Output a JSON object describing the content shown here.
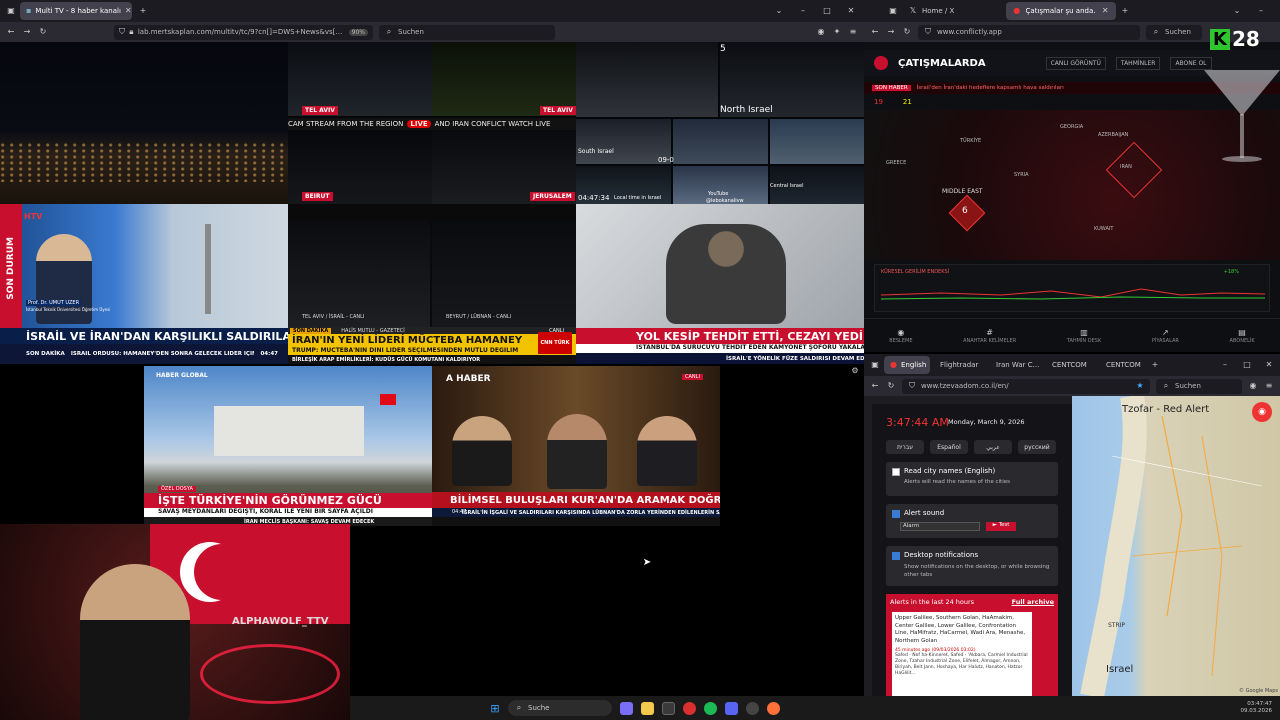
{
  "left_browser": {
    "tab_title": "Multi TV - 8 haber kanalı",
    "url": "lab.mertskaplan.com/multitv/tc/9?cn[]=DWS+News&vs[]=3h-gYIFp6Cg&cn[]=&vs[]=&cn[]=Sokak+Kedisi&vs[]=&cn[]=...",
    "zoom": "90%",
    "search_placeholder": "Suchen"
  },
  "videos": {
    "cam2_tel_aviv_1": "TEL AVIV",
    "cam2_tel_aviv_2": "TEL AVIV",
    "cam2_beirut": "BEIRUT",
    "cam2_jerusalem": "JERUSALEM",
    "cam2_ticker": "CAM STREAM FROM THE REGION",
    "cam2_live": "LIVE",
    "cam2_ticker2": "AND IRAN CONFLICT WATCH LIVE",
    "cam3_number": "5",
    "cam3_north_israel": "North Israel",
    "cam3_time": "09-0",
    "cam3_clock": "04:47:34",
    "cam3_local": "Local time in Israel",
    "cam3_south_israel": "South Israel",
    "cam3_central_israel": "Central Israel",
    "cam3_youtube": "YouTube",
    "cam3_handle": "@lebokanalivw",
    "ch4_side": "SON DURUM",
    "ch4_logo": "HTV",
    "ch4_guest": "Prof. Dr. UMUT UZER",
    "ch4_guest_sub": "İstanbul Teknik Üniversitesi Öğretim Üyesi",
    "ch4_headline": "İSRAİL VE İRAN'DAN KARŞILIKLI SALDIRILAR",
    "ch4_ticker_label": "SON DAKİKA",
    "ch4_ticker": "İSRAİL ORDUSU: HAMANEY'DEN SONRA GELECEK LİDER İÇİN LİDERİ HEDEF ALMAYA DEVAM EDECEĞİZ",
    "ch4_time": "04:47",
    "ch5_cap1": "TEL AVIV / İSRAİL - CANLI",
    "ch5_cap2": "BEYRUT / LÜBNAN - CANLI",
    "ch5_label": "SON DAKİKA",
    "ch5_guest": "HALİS MUTLU - GAZETECİ",
    "ch5_headline": "İRAN'IN YENİ LİDERİ MÜCTEBA HAMANEY",
    "ch5_sub": "TRUMP: MÜCTEBA'NIN DİNİ LİDER SEÇİLMESİNDEN MUTLU DEĞİLİM",
    "ch5_brand": "CNN TÜRK",
    "ch5_canli": "CANLI",
    "ch5_ticker": "BİRLEŞİK ARAP EMİRLİKLERİ: KUDÜS GÜCÜ KOMUTANI KALDIRIYOR",
    "ch6_headline": "YOL KESİP TEHDİT ETTİ, CEZAYI YEDİ",
    "ch6_sub": "İSTANBUL'DA SÜRÜCÜYÜ TEHDİT EDEN KAMYONET ŞOFÖRÜ YAKALANDI",
    "ch6_ticker": "İSRAİL'E YÖNELİK FÜZE SALDIRISI DEVAM EDİYOR",
    "ch7_logo": "HABER GLOBAL",
    "ch7_tag": "ÖZEL DOSYA",
    "ch7_headline": "İŞTE TÜRKİYE'NİN GÖRÜNMEZ GÜCÜ",
    "ch7_sub": "SAVAŞ MEYDANLARI DEĞİŞTİ, KORAL İLE YENİ BİR SAYFA AÇILDI",
    "ch7_ticker": "İRAN MECLİS BAŞKANI: SAVAŞ DEVAM EDECEK",
    "ch8_brand": "A HABER",
    "ch8_canli": "CANLI",
    "ch8_headline": "BİLİMSEL BULUŞLARI KUR'AN'DA ARAMAK DOĞRU MU?",
    "ch8_ticker": "İSRAİL'İN İŞGALİ VE SALDIRILARI KARŞISINDA LÜBNAN'DA ZORLA YERİNDEN EDİLENLERİN SAYISI",
    "ch8_time": "04:47",
    "webcam_text": "ALPHAWOLF_TTV"
  },
  "right_top_browser": {
    "tab1": "Home / X",
    "tab2": "Çatışmalar şu anda...",
    "url": "www.conflictly.app",
    "search_placeholder": "Suchen",
    "app_title": "ÇATIŞMALARDA",
    "nav_live": "CANLI GÖRÜNTÜ",
    "nav_forecast": "TAHMİNLER",
    "nav_subscribe": "ABONE OL",
    "alert_label": "SON HABER",
    "alert_text": "İsrail'den İran'daki hedeflere kapsamlı hava saldırıları",
    "count_stats": "19",
    "count_alerts": "21",
    "map_labels": [
      "TÜRKİYE",
      "GEORGIA",
      "AZERBAIJAN",
      "MIDDLE EAST",
      "IRAN",
      "KUWAIT",
      "GREECE",
      "SYRIA"
    ],
    "region_count": "6",
    "tension_label": "KÜRESEL GERİLİM ENDEKSİ",
    "tension_value": "+18%",
    "bottom_nav": [
      "BESLEME",
      "ANAHTAR KELİMELER",
      "TAHMİN DESK",
      "PİYASALAR",
      "ABONELİK"
    ],
    "kanal": "28"
  },
  "right_bottom_browser": {
    "tab1": "English",
    "tab2": "Flightradar",
    "tab3": "Iran War C...",
    "tab4": "CENTCOM",
    "tab5": "CENTCOM",
    "url": "www.tzevaadom.co.il/en/",
    "search_placeholder": "Suchen",
    "time": "3:47:44 AM",
    "date": "Monday, March 9, 2026",
    "lang1": "עברית",
    "lang2": "Español",
    "lang3": "عربي",
    "lang4": "русский",
    "opt1_title": "Read city names (English)",
    "opt1_desc": "Alerts will read the names of the cities",
    "opt2_title": "Alert sound",
    "opt2_select": "Alarm",
    "opt2_test": "► Test",
    "opt3_title": "Desktop notifications",
    "opt3_desc": "Show notifications on the desktop, or while browsing other tabs",
    "alerts_header": "Alerts in the last 24 hours",
    "full_archive": "Full archive",
    "alert_regions": "Upper Galilee, Southern Golan, HaAmakim, Center Galilee, Lower Galilee, Confrontation Line, HaMifratz, HaCarmel, Wadi Ara, Menashe, Northern Golan",
    "alert_time": "45 minutes ago (09/03/2026 03:02)",
    "alert_more": "Safed - Nof ha-Kinneret, Safed - 'Akbara, Carmiel Industrial Zone, Tzahar Industrial Zone, Elifelet, Almagor, Amnon, Biriyah, Beit Jann, Hoshaya, Har Halutz, Hanaton, Hatzor HaGlilit...",
    "map_title": "Tzofar - Red Alert",
    "map_israel": "Israel",
    "map_strip": "STRIP",
    "map_credit": "© Google Maps"
  },
  "taskbar": {
    "search": "Suche",
    "time": "03:47:47",
    "date": "09.03.2026"
  }
}
